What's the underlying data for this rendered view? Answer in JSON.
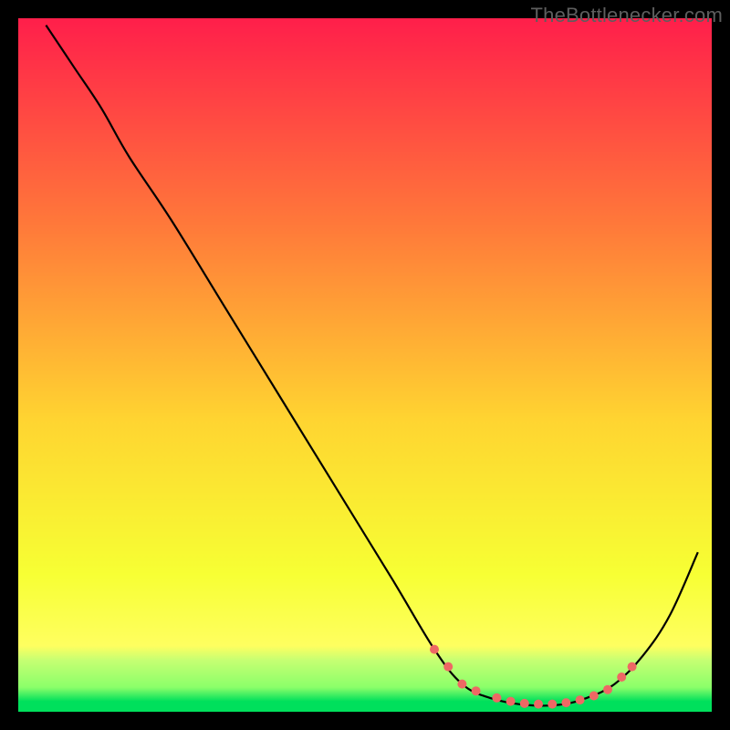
{
  "attribution": "TheBottlenecker.com",
  "colors": {
    "top": "#ff1f4b",
    "mid_upper": "#ff7a3a",
    "mid": "#ffd531",
    "mid_lower": "#f7ff34",
    "band_light": "#c8ff73",
    "bottom": "#00e05c",
    "curve": "#000000",
    "marker": "#ee6864"
  },
  "chart_data": {
    "type": "line",
    "title": "",
    "xlabel": "",
    "ylabel": "",
    "xlim": [
      0,
      100
    ],
    "ylim": [
      0,
      100
    ],
    "curve": [
      {
        "x": 4,
        "y": 99
      },
      {
        "x": 8,
        "y": 93
      },
      {
        "x": 12,
        "y": 87
      },
      {
        "x": 16,
        "y": 80
      },
      {
        "x": 22,
        "y": 71
      },
      {
        "x": 30,
        "y": 58
      },
      {
        "x": 38,
        "y": 45
      },
      {
        "x": 46,
        "y": 32
      },
      {
        "x": 54,
        "y": 19
      },
      {
        "x": 60,
        "y": 9
      },
      {
        "x": 64,
        "y": 4
      },
      {
        "x": 68,
        "y": 2
      },
      {
        "x": 73,
        "y": 1
      },
      {
        "x": 78,
        "y": 1
      },
      {
        "x": 82,
        "y": 2
      },
      {
        "x": 86,
        "y": 4
      },
      {
        "x": 90,
        "y": 8
      },
      {
        "x": 94,
        "y": 14
      },
      {
        "x": 98,
        "y": 23
      }
    ],
    "markers": [
      {
        "x": 60,
        "y": 9
      },
      {
        "x": 62,
        "y": 6.5
      },
      {
        "x": 64,
        "y": 4
      },
      {
        "x": 66,
        "y": 3
      },
      {
        "x": 69,
        "y": 2
      },
      {
        "x": 71,
        "y": 1.5
      },
      {
        "x": 73,
        "y": 1.2
      },
      {
        "x": 75,
        "y": 1.1
      },
      {
        "x": 77,
        "y": 1.1
      },
      {
        "x": 79,
        "y": 1.3
      },
      {
        "x": 81,
        "y": 1.7
      },
      {
        "x": 83,
        "y": 2.3
      },
      {
        "x": 85,
        "y": 3.2
      },
      {
        "x": 87,
        "y": 5
      },
      {
        "x": 88.5,
        "y": 6.5
      }
    ]
  }
}
